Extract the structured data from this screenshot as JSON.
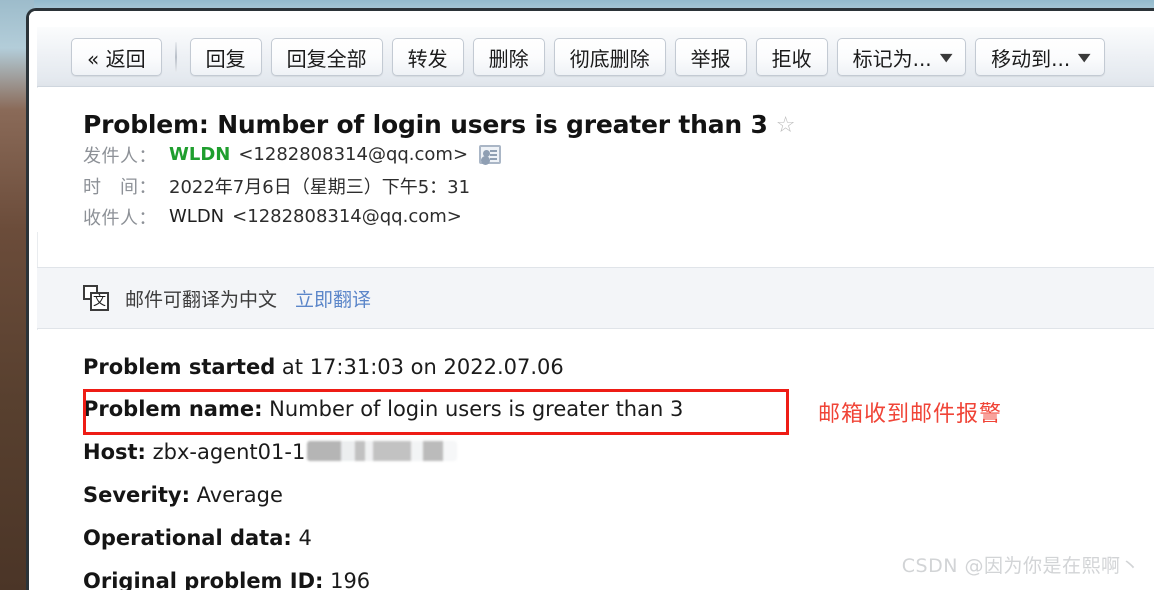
{
  "window": {
    "app": "qq-mail-reader"
  },
  "toolbar": {
    "buttons": [
      {
        "label": "« 返回",
        "name": "back-button",
        "dropdown": false
      },
      {
        "label": "回复",
        "name": "reply-button",
        "dropdown": false
      },
      {
        "label": "回复全部",
        "name": "reply-all-button",
        "dropdown": false
      },
      {
        "label": "转发",
        "name": "forward-button",
        "dropdown": false
      },
      {
        "label": "删除",
        "name": "delete-button",
        "dropdown": false
      },
      {
        "label": "彻底删除",
        "name": "delete-permanently-button",
        "dropdown": false
      },
      {
        "label": "举报",
        "name": "report-button",
        "dropdown": false
      },
      {
        "label": "拒收",
        "name": "reject-button",
        "dropdown": false
      },
      {
        "label": "标记为... ",
        "name": "mark-as-button",
        "dropdown": true
      },
      {
        "label": "移动到... ",
        "name": "move-to-button",
        "dropdown": true
      }
    ],
    "dropdown_glyph": "▼"
  },
  "mail": {
    "subject": "Problem: Number of login users is greater than 3",
    "star_glyph": "☆",
    "from_label": "发件人：",
    "from_name": "WLDN",
    "from_address": "<1282808314@qq.com>",
    "date_label": "时　间：",
    "date_value": "2022年7月6日（星期三）下午5：31",
    "to_label": "收件人：",
    "to_name": "WLDN",
    "to_address": "<1282808314@qq.com>"
  },
  "translate": {
    "icon_glyph": "文",
    "text": "邮件可翻译为中文",
    "link": "立即翻译"
  },
  "body": {
    "started_label": "Problem started",
    "started_value": " at 17:31:03 on 2022.07.06",
    "name_label": "Problem name:",
    "name_value": " Number of login users is greater than 3",
    "host_label": "Host:",
    "host_value": " zbx-agent01-1",
    "severity_label": "Severity:",
    "severity_value": " Average",
    "opdata_label": "Operational data:",
    "opdata_value": " 4",
    "problemid_label": "Original problem ID:",
    "problemid_value": " 196"
  },
  "annotation": {
    "note_text": "邮箱收到邮件报警",
    "note_color": "#f04437",
    "box_color": "#ee1c15"
  },
  "watermark": {
    "text": "CSDN @因为你是在熙啊丶"
  }
}
